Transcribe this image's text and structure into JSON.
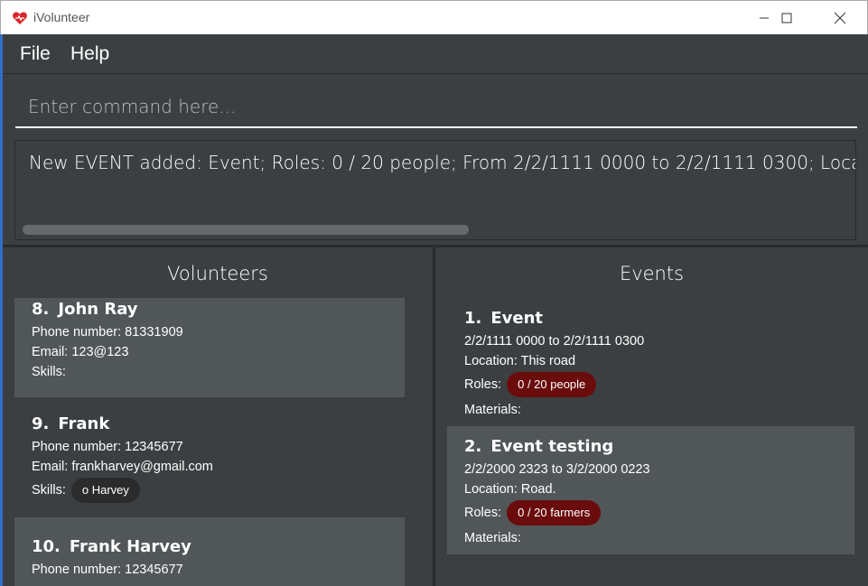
{
  "window": {
    "title": "iVolunteer"
  },
  "menu": {
    "file": "File",
    "help": "Help"
  },
  "command": {
    "placeholder": "Enter command here..."
  },
  "result": {
    "text": "New EVENT added: Event; Roles: 0 / 20 people; From 2/2/1111 0000 to 2/2/1111 0300; Location: This road"
  },
  "volunteers": {
    "title": "Volunteers",
    "items": [
      {
        "index": "8.",
        "name": "John Ray",
        "phone": "Phone number: 81331909",
        "email": "Email: 123@123",
        "skills_label": "Skills:",
        "skills": []
      },
      {
        "index": "9.",
        "name": "Frank",
        "phone": "Phone number: 12345677",
        "email": "Email: frankharvey@gmail.com",
        "skills_label": "Skills:",
        "skills": [
          "o Harvey"
        ]
      },
      {
        "index": "10.",
        "name": "Frank Harvey",
        "phone": "Phone number: 12345677"
      }
    ]
  },
  "events": {
    "title": "Events",
    "items": [
      {
        "index": "1.",
        "name": "Event",
        "time": "2/2/1111 0000 to 2/2/1111 0300",
        "location": "Location: This road",
        "roles_label": "Roles:",
        "roles": [
          "0 / 20 people"
        ],
        "materials": "Materials:"
      },
      {
        "index": "2.",
        "name": "Event testing",
        "time": "2/2/2000 2323 to 3/2/2000 0223",
        "location": "Location: Road.",
        "roles_label": "Roles:",
        "roles": [
          "0 / 20 farmers"
        ],
        "materials": "Materials:"
      }
    ]
  },
  "colors": {
    "background": "#3c3f41",
    "card_light": "#515658",
    "role_tag": "#6a0c0c",
    "skill_tag": "#2b2b2b"
  },
  "icons": {
    "app": "heart-logo-icon",
    "minimize": "minimize-icon",
    "maximize": "maximize-icon",
    "close": "close-icon"
  }
}
